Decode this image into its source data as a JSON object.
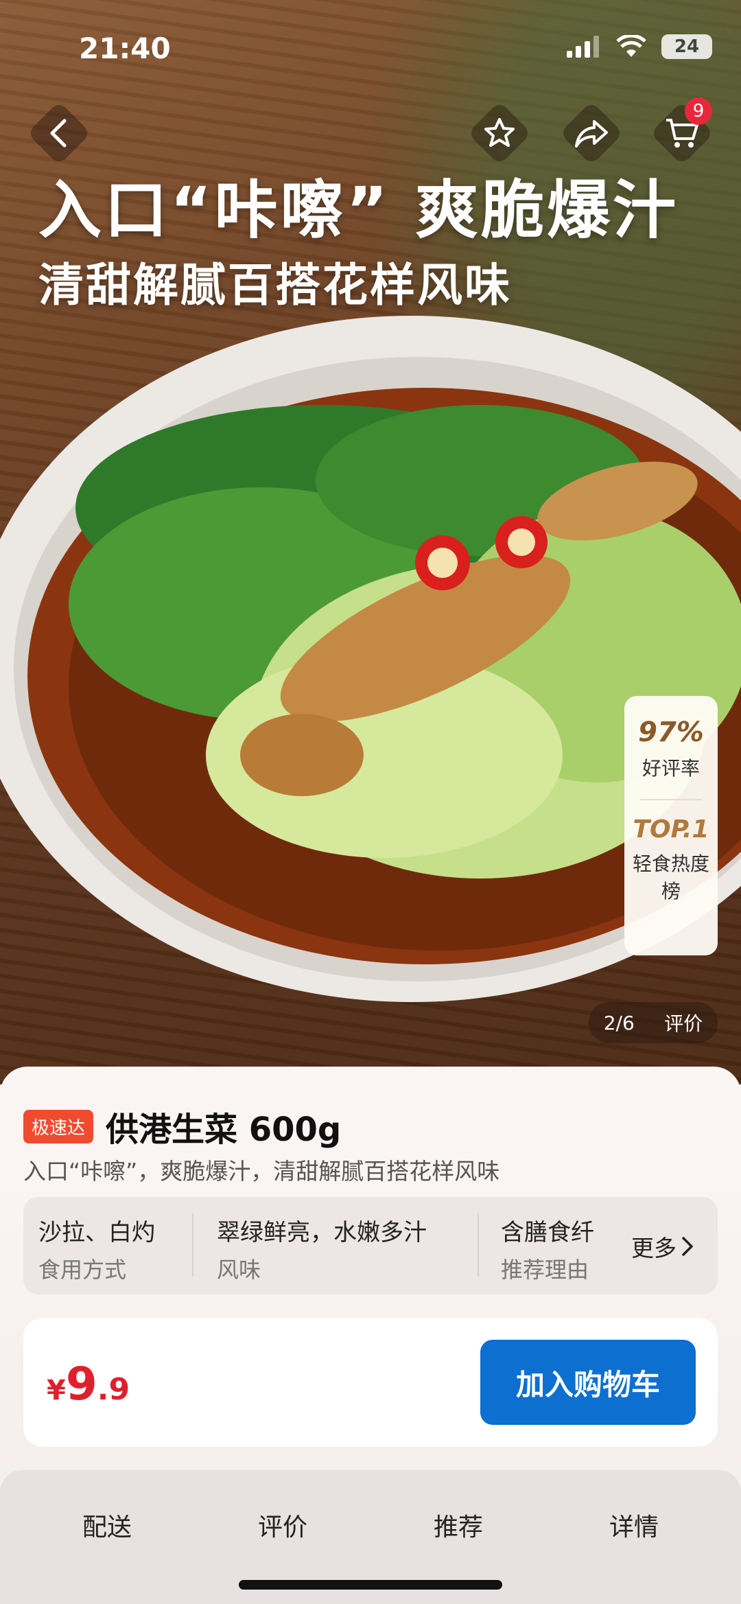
{
  "status_bar": {
    "time": "21:40",
    "battery": "24"
  },
  "nav": {
    "cart_count": "9"
  },
  "hero": {
    "headline": "入口“咔嚓”  爽脆爆汁",
    "subline": "清甜解腻百搭花样风味",
    "rating": {
      "percent": "97%",
      "percent_label": "好评率",
      "top": "TOP.1",
      "rank_label": "轻食热度榜"
    },
    "image_counter": "2/6",
    "review_link": "评价"
  },
  "product": {
    "tag": "极速达",
    "title": "供港生菜 600g",
    "description": "入口“咔嚓”，爽脆爆汁，清甜解腻百搭花样风味",
    "attributes": [
      {
        "value": "沙拉、白灼",
        "key": "食用方式"
      },
      {
        "value": "翠绿鲜亮，水嫩多汁",
        "key": "风味"
      },
      {
        "value": "含膳食纤",
        "key": "推荐理由"
      }
    ],
    "more_label": "更多",
    "price": {
      "currency": "¥",
      "integer": "9",
      "decimal": ".9"
    },
    "add_to_cart": "加入购物车"
  },
  "tabs": [
    "配送",
    "评价",
    "推荐",
    "详情"
  ],
  "colors": {
    "accent_blue": "#0d6fd0",
    "price_red": "#e01f2d",
    "badge_red": "#e8283a",
    "tag_orange": "#f04b2f"
  }
}
